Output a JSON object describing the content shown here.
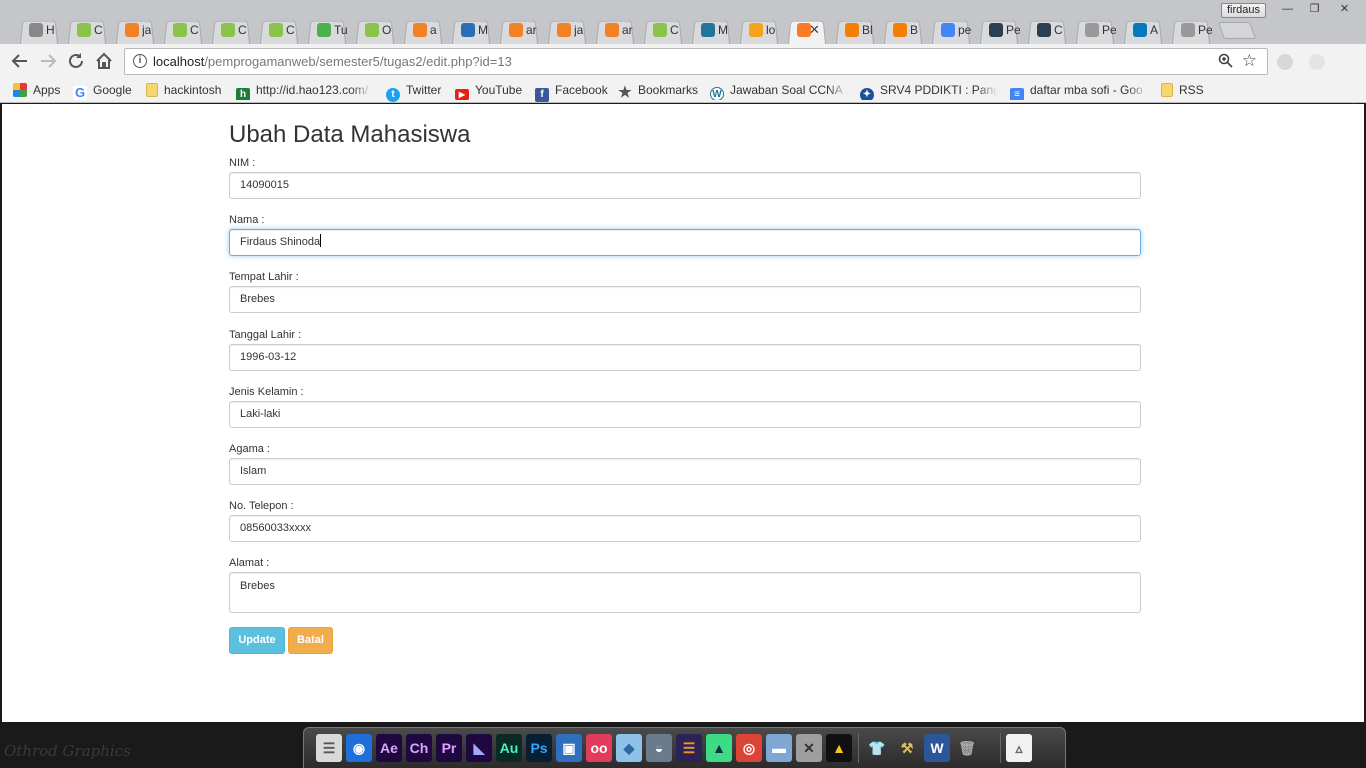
{
  "window": {
    "user": "firdaus",
    "minimize": "—",
    "restore": "❐",
    "close": "✕"
  },
  "tabs": [
    {
      "icon": "history-icon",
      "label": "H",
      "color": "#888"
    },
    {
      "icon": "android-icon",
      "label": "C",
      "color": "#8bc34a"
    },
    {
      "icon": "stackoverflow-icon",
      "label": "ja",
      "color": "#f48024"
    },
    {
      "icon": "android-icon",
      "label": "C",
      "color": "#8bc34a"
    },
    {
      "icon": "android-icon",
      "label": "C",
      "color": "#8bc34a"
    },
    {
      "icon": "android-icon",
      "label": "C",
      "color": "#8bc34a"
    },
    {
      "icon": "virus-icon",
      "label": "Tu",
      "color": "#4caf50"
    },
    {
      "icon": "android-icon",
      "label": "O",
      "color": "#8bc34a"
    },
    {
      "icon": "stackoverflow-icon",
      "label": "a",
      "color": "#f48024"
    },
    {
      "icon": "app-icon",
      "label": "M",
      "color": "#2a6fb5"
    },
    {
      "icon": "stackoverflow-icon",
      "label": "ar",
      "color": "#f48024"
    },
    {
      "icon": "stackoverflow-icon",
      "label": "ja",
      "color": "#f48024"
    },
    {
      "icon": "stackoverflow-icon",
      "label": "ar",
      "color": "#f48024"
    },
    {
      "icon": "android-icon",
      "label": "C",
      "color": "#8bc34a"
    },
    {
      "icon": "wordpress-icon",
      "label": "M",
      "color": "#21759b"
    },
    {
      "icon": "phpmyadmin-icon",
      "label": "lo",
      "color": "#f7a21b"
    },
    {
      "icon": "xampp-icon",
      "label": "",
      "color": "#fb7a24",
      "active": true
    },
    {
      "icon": "blogger-icon",
      "label": "Bl",
      "color": "#f57d00"
    },
    {
      "icon": "blogger-icon",
      "label": "B",
      "color": "#f57d00"
    },
    {
      "icon": "google-icon",
      "label": "pe",
      "color": "#4285f4"
    },
    {
      "icon": "dicoding-icon",
      "label": "Pe",
      "color": "#2d3e50"
    },
    {
      "icon": "dicoding-icon",
      "label": "C",
      "color": "#2d3e50"
    },
    {
      "icon": "page-icon",
      "label": "Pe",
      "color": "#999"
    },
    {
      "icon": "drupal-icon",
      "label": "A",
      "color": "#0678be"
    },
    {
      "icon": "page-icon",
      "label": "Pe",
      "color": "#999"
    }
  ],
  "address": {
    "host": "localhost",
    "path": "/pemprogamanweb/semester5/tugas2/edit.php?id=13"
  },
  "bookmarks": [
    {
      "label": "Apps",
      "icon": "apps-icon"
    },
    {
      "label": "Google",
      "icon": "google-icon"
    },
    {
      "label": "hackintosh",
      "icon": "folder-icon"
    },
    {
      "label": "http://id.hao123.com/",
      "icon": "hao123-icon"
    },
    {
      "label": "Twitter",
      "icon": "twitter-icon"
    },
    {
      "label": "YouTube",
      "icon": "youtube-icon"
    },
    {
      "label": "Facebook",
      "icon": "facebook-icon"
    },
    {
      "label": "Bookmarks",
      "icon": "star-icon"
    },
    {
      "label": "Jawaban Soal CCNA 1",
      "icon": "wordpress-icon"
    },
    {
      "label": "SRV4 PDDIKTI : Pangk",
      "icon": "pddikti-icon"
    },
    {
      "label": "daftar mba sofi - Goo",
      "icon": "docs-icon"
    },
    {
      "label": "RSS",
      "icon": "folder-icon"
    }
  ],
  "form": {
    "title": "Ubah Data Mahasiswa",
    "fields": [
      {
        "label": "NIM :",
        "value": "14090015"
      },
      {
        "label": "Nama :",
        "value": "Firdaus Shinoda"
      },
      {
        "label": "Tempat Lahir :",
        "value": "Brebes"
      },
      {
        "label": "Tanggal Lahir :",
        "value": "1996-03-12"
      },
      {
        "label": "Jenis Kelamin :",
        "value": "Laki-laki"
      },
      {
        "label": "Agama :",
        "value": "Islam"
      },
      {
        "label": "No. Telepon :",
        "value": "08560033xxxx"
      },
      {
        "label": "Alamat :",
        "value": "Brebes"
      }
    ],
    "update_label": "Update",
    "cancel_label": "Batal"
  },
  "desktop": {
    "watermark": "Othrod Graphics"
  },
  "dock": [
    {
      "name": "finder-icon",
      "text": "☰",
      "bg": "#d9d9d9",
      "fg": "#555"
    },
    {
      "name": "wifi-icon",
      "text": "◉",
      "bg": "#1e6fd9",
      "fg": "#fff"
    },
    {
      "name": "after-effects-icon",
      "text": "Ae",
      "bg": "#1f0740",
      "fg": "#d7a6ff"
    },
    {
      "name": "character-animator-icon",
      "text": "Ch",
      "bg": "#1f0740",
      "fg": "#d7a6ff"
    },
    {
      "name": "premiere-icon",
      "text": "Pr",
      "bg": "#1f0740",
      "fg": "#e0a3ff"
    },
    {
      "name": "media-encoder-icon",
      "text": "◣",
      "bg": "#1f0740",
      "fg": "#a6a6ff"
    },
    {
      "name": "audition-icon",
      "text": "Au",
      "bg": "#0b2a24",
      "fg": "#42f5c8"
    },
    {
      "name": "photoshop-icon",
      "text": "Ps",
      "bg": "#071e33",
      "fg": "#31a8ff"
    },
    {
      "name": "window-icon",
      "text": "▣",
      "bg": "#2f6fbf",
      "fg": "#fff"
    },
    {
      "name": "flickr-icon",
      "text": "oo",
      "bg": "#e33b5c",
      "fg": "#fff"
    },
    {
      "name": "virtualbox-icon",
      "text": "◆",
      "bg": "#8ec2e8",
      "fg": "#2a6aa0"
    },
    {
      "name": "preview-icon",
      "text": "◒",
      "bg": "#6a7b8c",
      "fg": "#fff"
    },
    {
      "name": "eclipse-icon",
      "text": "☰",
      "bg": "#2c2255",
      "fg": "#f7941e"
    },
    {
      "name": "android-studio-icon",
      "text": "▲",
      "bg": "#3ddc84",
      "fg": "#073042"
    },
    {
      "name": "chrome-icon",
      "text": "◎",
      "bg": "#db4437",
      "fg": "#fff"
    },
    {
      "name": "folder-icon",
      "text": "▬",
      "bg": "#7fa7d4",
      "fg": "#fff"
    },
    {
      "name": "tools-icon",
      "text": "✕",
      "bg": "#9e9e9e",
      "fg": "#333"
    },
    {
      "name": "autodesk-icon",
      "text": "▲",
      "bg": "#111",
      "fg": "#f5c518"
    },
    {
      "name": "shirt-icon",
      "text": "👕",
      "bg": "transparent",
      "fg": "#111"
    },
    {
      "name": "hammer-icon",
      "text": "⚒",
      "bg": "transparent",
      "fg": "#e0c060"
    },
    {
      "name": "word-icon",
      "text": "W",
      "bg": "#2b579a",
      "fg": "#fff"
    },
    {
      "name": "trash-icon",
      "text": "🗑",
      "bg": "transparent",
      "fg": "#aaa"
    },
    {
      "name": "document-icon",
      "text": "▵",
      "bg": "#f2f2f2",
      "fg": "#666"
    }
  ]
}
